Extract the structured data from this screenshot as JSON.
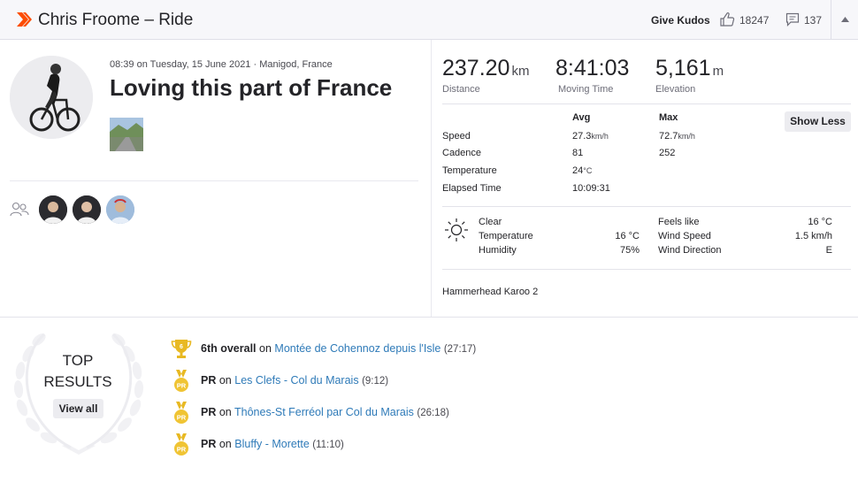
{
  "header": {
    "title": "Chris Froome – Ride",
    "give_kudos_label": "Give Kudos",
    "kudos_count": "18247",
    "comment_count": "137"
  },
  "activity": {
    "meta": "08:39 on Tuesday, 15 June 2021 · Manigod, France",
    "title": "Loving this part of France"
  },
  "stats": {
    "distance": {
      "value": "237.20",
      "unit": "km",
      "label": "Distance"
    },
    "moving_time": {
      "value": "8:41:03",
      "label": "Moving Time"
    },
    "elevation": {
      "value": "5,161",
      "unit": "m",
      "label": "Elevation"
    }
  },
  "details": {
    "avg_header": "Avg",
    "max_header": "Max",
    "show_less_label": "Show Less",
    "rows": [
      {
        "label": "Speed",
        "avg": "27.3",
        "avg_unit": "km/h",
        "max": "72.7",
        "max_unit": "km/h"
      },
      {
        "label": "Cadence",
        "avg": "81",
        "avg_unit": "",
        "max": "252",
        "max_unit": ""
      },
      {
        "label": "Temperature",
        "avg": "24",
        "avg_unit": "°C",
        "max": "",
        "max_unit": ""
      },
      {
        "label": "Elapsed Time",
        "avg": "10:09:31",
        "avg_unit": "",
        "max": "",
        "max_unit": ""
      }
    ]
  },
  "weather": {
    "condition": "Clear",
    "temperature_label": "Temperature",
    "temperature": "16 °C",
    "humidity_label": "Humidity",
    "humidity": "75%",
    "feels_like_label": "Feels like",
    "feels_like": "16 °C",
    "wind_speed_label": "Wind Speed",
    "wind_speed": "1.5 km/h",
    "wind_direction_label": "Wind Direction",
    "wind_direction": "E"
  },
  "device": "Hammerhead Karoo 2",
  "top_results": {
    "heading_line1": "TOP",
    "heading_line2": "RESULTS",
    "view_all_label": "View all",
    "items": [
      {
        "rank": "6th overall",
        "on": "on",
        "segment": "Montée de Cohennoz depuis l'Isle",
        "time": "(27:17)",
        "medal": "trophy",
        "badge_text": "6"
      },
      {
        "rank": "PR",
        "on": "on",
        "segment": "Les Clefs - Col du Marais",
        "time": "(9:12)",
        "medal": "pr",
        "badge_text": "PR"
      },
      {
        "rank": "PR",
        "on": "on",
        "segment": "Thônes-St Ferréol par Col du Marais",
        "time": "(26:18)",
        "medal": "pr",
        "badge_text": "PR"
      },
      {
        "rank": "PR",
        "on": "on",
        "segment": "Bluffy - Morette",
        "time": "(11:10)",
        "medal": "pr",
        "badge_text": "PR"
      }
    ]
  },
  "colors": {
    "brand": "#fc4c02",
    "link": "#2e7ab8",
    "gold": "#e8b923"
  }
}
